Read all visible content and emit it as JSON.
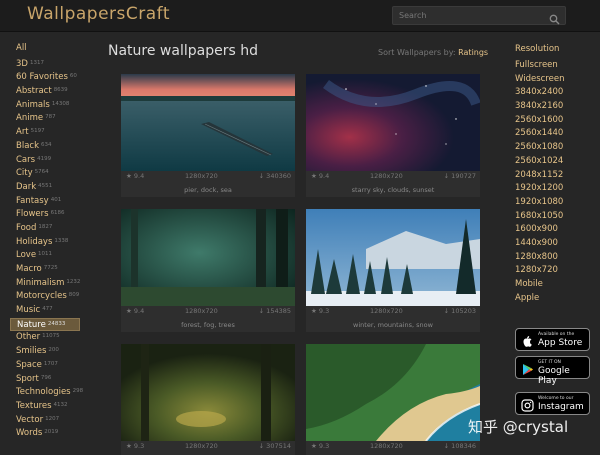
{
  "header": {
    "logo": "WallpapersCraft",
    "search_placeholder": "Search"
  },
  "sidebar": {
    "all_label": "All",
    "categories": [
      {
        "label": "3D",
        "count": "1317"
      },
      {
        "label": "60 Favorites",
        "count": "60"
      },
      {
        "label": "Abstract",
        "count": "8639"
      },
      {
        "label": "Animals",
        "count": "14308"
      },
      {
        "label": "Anime",
        "count": "787"
      },
      {
        "label": "Art",
        "count": "5197"
      },
      {
        "label": "Black",
        "count": "634"
      },
      {
        "label": "Cars",
        "count": "4199"
      },
      {
        "label": "City",
        "count": "5764"
      },
      {
        "label": "Dark",
        "count": "4551"
      },
      {
        "label": "Fantasy",
        "count": "401"
      },
      {
        "label": "Flowers",
        "count": "6186"
      },
      {
        "label": "Food",
        "count": "1827"
      },
      {
        "label": "Holidays",
        "count": "1338"
      },
      {
        "label": "Love",
        "count": "1011"
      },
      {
        "label": "Macro",
        "count": "7725"
      },
      {
        "label": "Minimalism",
        "count": "1232"
      },
      {
        "label": "Motorcycles",
        "count": "809"
      },
      {
        "label": "Music",
        "count": "477"
      },
      {
        "label": "Nature",
        "count": "24833",
        "active": true
      },
      {
        "label": "Other",
        "count": "11075"
      },
      {
        "label": "Smilies",
        "count": "200"
      },
      {
        "label": "Space",
        "count": "1707"
      },
      {
        "label": "Sport",
        "count": "796"
      },
      {
        "label": "Technologies",
        "count": "298"
      },
      {
        "label": "Textures",
        "count": "4132"
      },
      {
        "label": "Vector",
        "count": "1207"
      },
      {
        "label": "Words",
        "count": "2019"
      }
    ]
  },
  "main": {
    "title": "Nature wallpapers hd",
    "sort_label": "Sort Wallpapers by:",
    "sort_value": "Ratings",
    "wallpapers": [
      {
        "rating": "9.4",
        "resolution": "1280x720",
        "downloads": "340360",
        "tags": "pier, dock, sea"
      },
      {
        "rating": "9.4",
        "resolution": "1280x720",
        "downloads": "190727",
        "tags": "starry sky, clouds, sunset"
      },
      {
        "rating": "9.4",
        "resolution": "1280x720",
        "downloads": "154385",
        "tags": "forest, fog, trees"
      },
      {
        "rating": "9.3",
        "resolution": "1280x720",
        "downloads": "105203",
        "tags": "winter, mountains, snow"
      },
      {
        "rating": "9.3",
        "resolution": "1280x720",
        "downloads": "307514",
        "tags": ""
      },
      {
        "rating": "9.3",
        "resolution": "1280x720",
        "downloads": "108346",
        "tags": ""
      }
    ]
  },
  "resolutions": {
    "heading": "Resolution",
    "items": [
      "Fullscreen",
      "Widescreen",
      "3840x2400",
      "3840x2160",
      "2560x1600",
      "2560x1440",
      "2560x1080",
      "2560x1024",
      "2048x1152",
      "1920x1200",
      "1920x1080",
      "1680x1050",
      "1600x900",
      "1440x900",
      "1280x800",
      "1280x720",
      "Mobile",
      "Apple"
    ]
  },
  "stores": [
    {
      "small": "Available on the",
      "big": "App Store",
      "icon": "apple-icon"
    },
    {
      "small": "GET IT ON",
      "big": "Google Play",
      "icon": "google-play-icon"
    },
    {
      "small": "Welcome to our",
      "big": "Instagram",
      "icon": "instagram-icon"
    }
  ],
  "watermark": "知乎 @crystal"
}
